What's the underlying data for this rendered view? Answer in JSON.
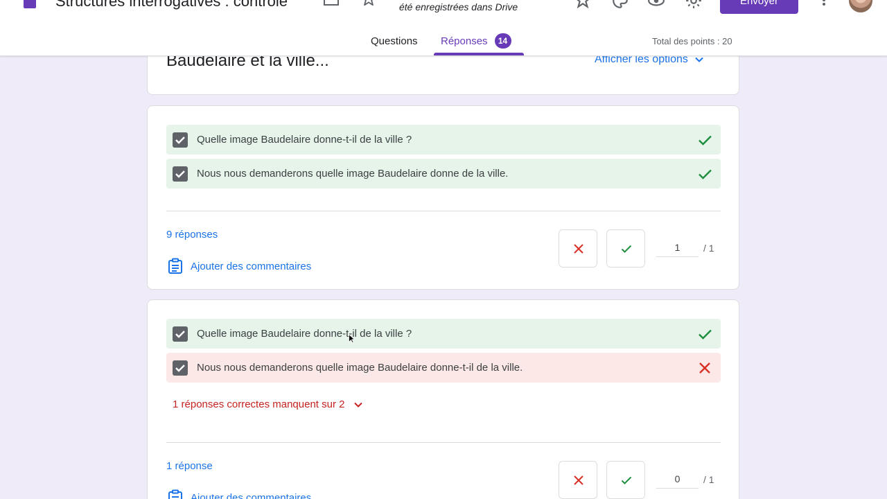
{
  "header": {
    "title": "Structures interrogatives : contrôle",
    "save_status": "été enregistrées dans Drive",
    "send_label": "Envoyer"
  },
  "tabs": [
    {
      "label": "Questions"
    },
    {
      "label": "Réponses",
      "badge": "14"
    }
  ],
  "total_points": "Total des points : 20",
  "summary_card": {
    "title": "Baudelaire et la ville...",
    "show_options": "Afficher les options"
  },
  "questions": [
    {
      "answers": [
        {
          "text": "Quelle image Baudelaire donne-t-il de la ville ?",
          "status": "correct"
        },
        {
          "text": "Nous nous demanderons quelle image Baudelaire donne de la ville.",
          "status": "correct"
        }
      ],
      "response_count": "9 réponses",
      "add_comments": "Ajouter des commentaires",
      "score": "1",
      "max_score": "/ 1"
    },
    {
      "answers": [
        {
          "text": "Quelle image Baudelaire donne-t-il de la ville ?",
          "status": "correct"
        },
        {
          "text": "Nous nous demanderons quelle image Baudelaire donne-t-il de la ville.",
          "status": "incorrect"
        }
      ],
      "missing_answers": "1 réponses correctes manquent sur 2",
      "response_count": "1 réponse",
      "add_comments": "Ajouter des commentaires",
      "score": "0",
      "max_score": "/ 1"
    }
  ],
  "colors": {
    "accent": "#673ab7",
    "link": "#1a73e8",
    "correct": "#1e8e3e",
    "incorrect": "#d93025",
    "page_bg": "#f0ebf8"
  }
}
